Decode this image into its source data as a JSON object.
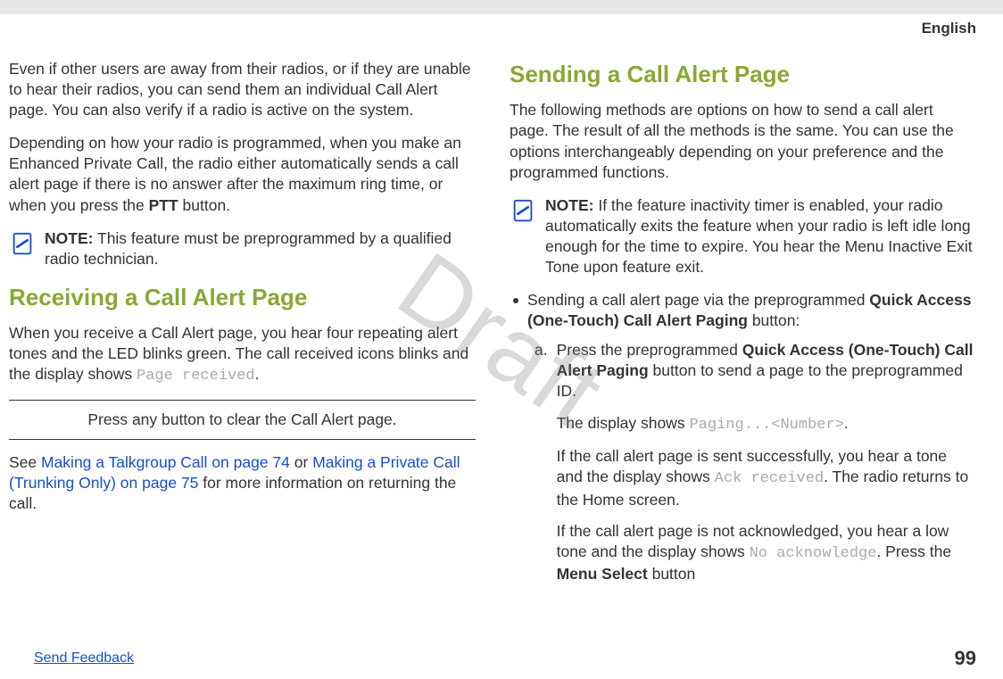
{
  "header": {
    "language": "English"
  },
  "watermark": "Draft",
  "left": {
    "p1": "Even if other users are away from their radios, or if they are unable to hear their radios, you can send them an individual Call Alert page. You can also verify if a radio is active on the system.",
    "p2a": "Depending on how your radio is programmed, when you make an Enhanced Private Call, the radio either automatically sends a call alert page if there is no answer after the maximum ring time, or when you press the ",
    "p2b": "PTT",
    "p2c": " button.",
    "note": {
      "label": "NOTE:",
      "text": "This feature must be preprogrammed by a qualified radio technician."
    },
    "h_recv": "Receiving a Call Alert Page",
    "recv_p_a": "When you receive a Call Alert page, you hear four repeating alert tones and the LED blinks green. The call received icons blinks and the display shows ",
    "recv_mono": "Page received",
    "recv_p_b": ".",
    "step": "Press any button to clear the Call Alert page.",
    "see_a": "See ",
    "link1": "Making a Talkgroup Call on page 74",
    "see_b": " or ",
    "link2": "Making a Private Call (Trunking Only) on page 75",
    "see_c": " for more information on returning the call."
  },
  "right": {
    "h_send": "Sending a Call Alert Page",
    "p1": "The following methods are options on how to send a call alert page. The result of all the methods is the same. You can use the options interchangeably depending on your preference and the programmed functions.",
    "note": {
      "label": "NOTE:",
      "text": "If the feature inactivity timer is enabled, your radio automatically exits the feature when your radio is left idle long enough for the time to expire. You hear the Menu Inactive Exit Tone upon feature exit."
    },
    "bullet": {
      "a": "Sending a call alert page via the preprogrammed ",
      "b": "Quick Access (One-Touch) Call Alert Paging",
      "c": " button:"
    },
    "ol_a": {
      "marker": "a.",
      "p1a": "Press the preprogrammed ",
      "p1b": "Quick Access (One-Touch) Call Alert Paging",
      "p1c": " button to send a page to the preprogrammed ID.",
      "p2a": "The display shows ",
      "p2m": "Paging...<Number>",
      "p2b": ".",
      "p3a": "If the call alert page is sent successfully, you hear a tone and the display shows ",
      "p3m": "Ack received",
      "p3b": ". The radio returns to the Home screen.",
      "p4a": "If the call alert page is not acknowledged, you hear a low tone and the display shows ",
      "p4m": "No acknowledge",
      "p4b": ". Press the ",
      "p4c": "Menu Select",
      "p4d": " button"
    }
  },
  "footer": {
    "feedback": "Send Feedback",
    "page": "99"
  }
}
